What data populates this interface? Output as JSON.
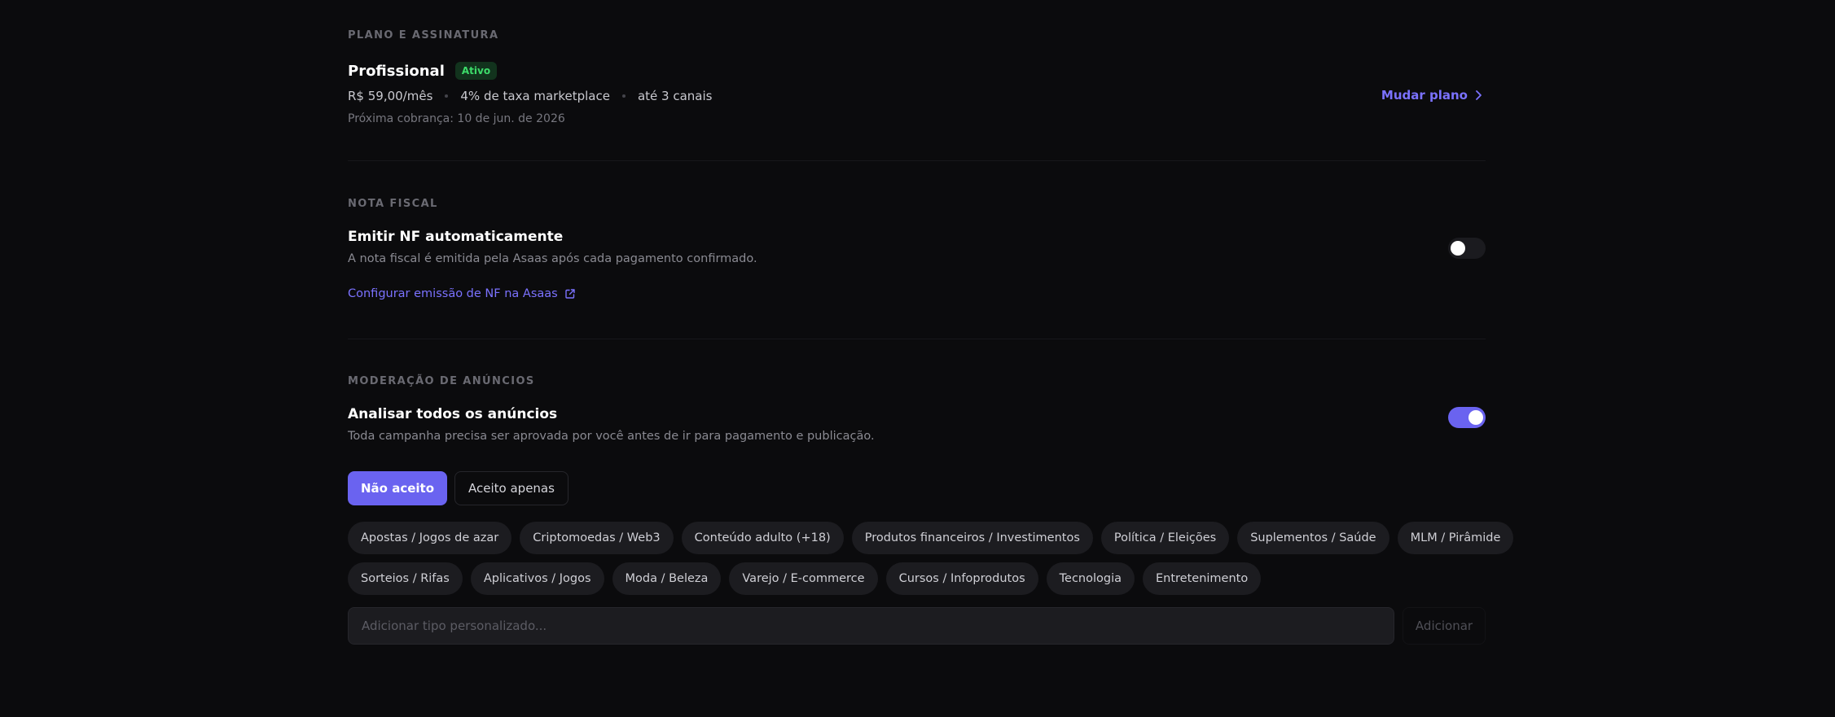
{
  "plan": {
    "section_title": "PLANO E ASSINATURA",
    "name": "Profissional",
    "status_badge": "Ativo",
    "price": "R$ 59,00/mês",
    "fee": "4% de taxa marketplace",
    "channels": "até 3 canais",
    "next_charge": "Próxima cobrança: 10 de jun. de 2026",
    "change_plan_label": "Mudar plano"
  },
  "nota_fiscal": {
    "section_title": "NOTA FISCAL",
    "title": "Emitir NF automaticamente",
    "description": "A nota fiscal é emitida pela Asaas após cada pagamento confirmado.",
    "config_link": "Configurar emissão de NF na Asaas",
    "toggle_on": false
  },
  "moderation": {
    "section_title": "MODERAÇÃO DE ANÚNCIOS",
    "title": "Analisar todos os anúncios",
    "description": "Toda campanha precisa ser aprovada por você antes de ir para pagamento e publicação.",
    "toggle_on": true,
    "mode_tabs": [
      "Não aceito",
      "Aceito apenas"
    ],
    "active_tab": "Não aceito",
    "chips_row1": [
      "Apostas / Jogos de azar",
      "Criptomoedas / Web3",
      "Conteúdo adulto (+18)",
      "Produtos financeiros / Investimentos",
      "Política / Eleições",
      "Suplementos / Saúde",
      "MLM / Pirâmide"
    ],
    "chips_row2": [
      "Sorteios / Rifas",
      "Aplicativos / Jogos",
      "Moda / Beleza",
      "Varejo / E-commerce",
      "Cursos / Infoprodutos",
      "Tecnologia",
      "Entretenimento"
    ],
    "custom_placeholder": "Adicionar tipo personalizado...",
    "add_label": "Adicionar"
  },
  "colors": {
    "background": "#0b0b0d",
    "accent": "#6a63f0",
    "link": "#7b72ff",
    "badge_text": "#3ddc6a",
    "badge_bg": "#12331d"
  }
}
